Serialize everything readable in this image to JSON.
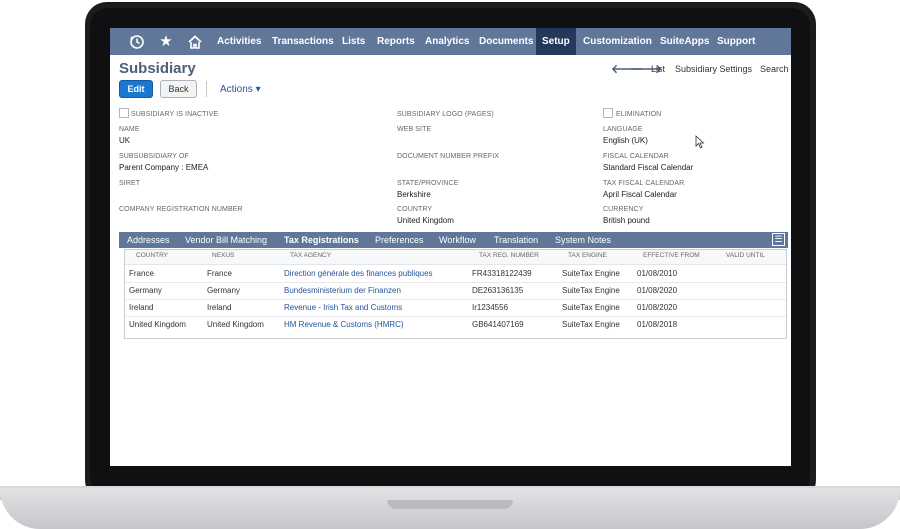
{
  "nav": {
    "items": [
      "Activities",
      "Transactions",
      "Lists",
      "Reports",
      "Analytics",
      "Documents",
      "Setup",
      "Customization",
      "SuiteApps",
      "Support"
    ],
    "active": "Setup"
  },
  "header": {
    "title": "Subsidiary",
    "right_links": [
      "List",
      "Subsidiary Settings",
      "Search"
    ]
  },
  "toolbar": {
    "edit_label": "Edit",
    "back_label": "Back",
    "actions_label": "Actions ▾"
  },
  "fields": {
    "inactive_label": "SUBSIDIARY IS INACTIVE",
    "logo_label": "SUBSIDIARY LOGO (PAGES)",
    "elimination_label": "ELIMINATION",
    "name_label": "NAME",
    "name_value": "UK",
    "website_label": "WEB SITE",
    "language_label": "LANGUAGE",
    "language_value": "English (UK)",
    "subof_label": "SUBSUBSIDIARY OF",
    "subof_value": "Parent Company : EMEA",
    "docprefix_label": "DOCUMENT NUMBER PREFIX",
    "fiscal_label": "FISCAL CALENDAR",
    "fiscal_value": "Standard Fiscal Calendar",
    "siret_label": "SIRET",
    "state_label": "STATE/PROVINCE",
    "state_value": "Berkshire",
    "taxfiscal_label": "TAX FISCAL CALENDAR",
    "taxfiscal_value": "April Fiscal Calendar",
    "companyreg_label": "COMPANY REGISTRATION NUMBER",
    "country_label": "COUNTRY",
    "country_value": "United Kingdom",
    "currency_label": "CURRENCY",
    "currency_value": "British pound"
  },
  "subtabs": [
    "Addresses",
    "Vendor Bill Matching",
    "Tax Registrations",
    "Preferences",
    "Workflow",
    "Translation",
    "System Notes"
  ],
  "active_subtab": "Tax Registrations",
  "table": {
    "headers": [
      "COUNTRY",
      "NEXUS",
      "TAX AGENCY",
      "TAX REG. NUMBER",
      "TAX ENGINE",
      "EFFECTIVE FROM",
      "VALID UNTIL"
    ],
    "rows": [
      [
        "France",
        "France",
        "Direction générale des finances publiques",
        "FR43318122439",
        "SuiteTax Engine",
        "01/08/2010",
        ""
      ],
      [
        "Germany",
        "Germany",
        "Bundesministerium der Finanzen",
        "DE263136135",
        "SuiteTax Engine",
        "01/08/2020",
        ""
      ],
      [
        "Ireland",
        "Ireland",
        "Revenue - Irish Tax and Customs",
        "Ir1234556",
        "SuiteTax Engine",
        "01/08/2020",
        ""
      ],
      [
        "United Kingdom",
        "United Kingdom",
        "HM Revenue & Customs (HMRC)",
        "GB641407169",
        "SuiteTax Engine",
        "01/08/2018",
        ""
      ]
    ]
  },
  "colors": {
    "nav_bg": "#607799",
    "nav_active": "#24385b",
    "link": "#255599",
    "edit_btn": "#1a78d2"
  }
}
